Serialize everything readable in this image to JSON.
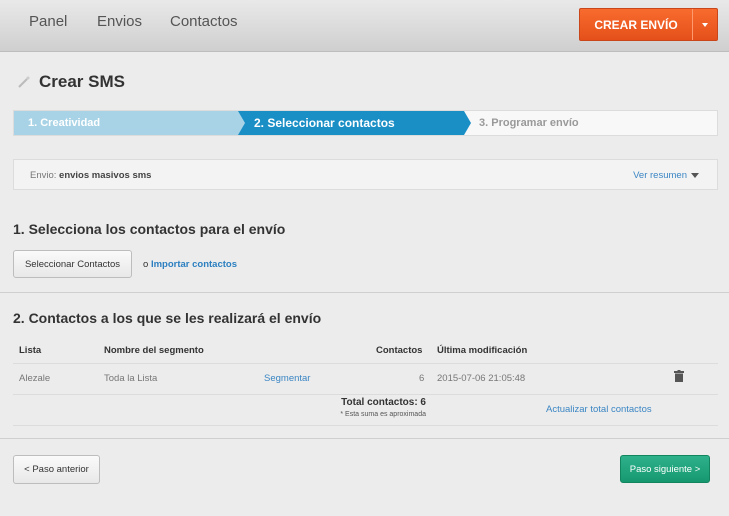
{
  "nav": {
    "items": [
      "Panel",
      "Envios",
      "Contactos"
    ]
  },
  "cta": {
    "label": "CREAR ENVÍO"
  },
  "page": {
    "title": "Crear SMS"
  },
  "wizard": {
    "steps": [
      "1. Creatividad",
      "2. Seleccionar contactos",
      "3. Programar envío"
    ]
  },
  "envio": {
    "label": "Envio:",
    "name": "envios masivos sms",
    "summary_link": "Ver resumen"
  },
  "section1": {
    "title": "1. Selecciona los contactos para el envío",
    "select_button": "Seleccionar Contactos",
    "or_text": "o",
    "import_link": "Importar contactos"
  },
  "section2": {
    "title": "2. Contactos a los que se les realizará el envío",
    "headers": {
      "lista": "Lista",
      "segmento": "Nombre del segmento",
      "contactos": "Contactos",
      "modificacion": "Última modificación"
    },
    "row": {
      "lista": "Alezale",
      "segmento": "Toda la Lista",
      "action": "Segmentar",
      "contactos": "6",
      "modificacion": "2015-07-06 21:05:48"
    },
    "total": "Total contactos: 6",
    "note": "* Esta suma es aproximada",
    "update_link": "Actualizar total contactos"
  },
  "footer": {
    "prev": "< Paso anterior",
    "next": "Paso siguiente >"
  },
  "colors": {
    "accent": "#1a8fc6",
    "cta": "#f05a22",
    "success": "#1fa37c"
  }
}
